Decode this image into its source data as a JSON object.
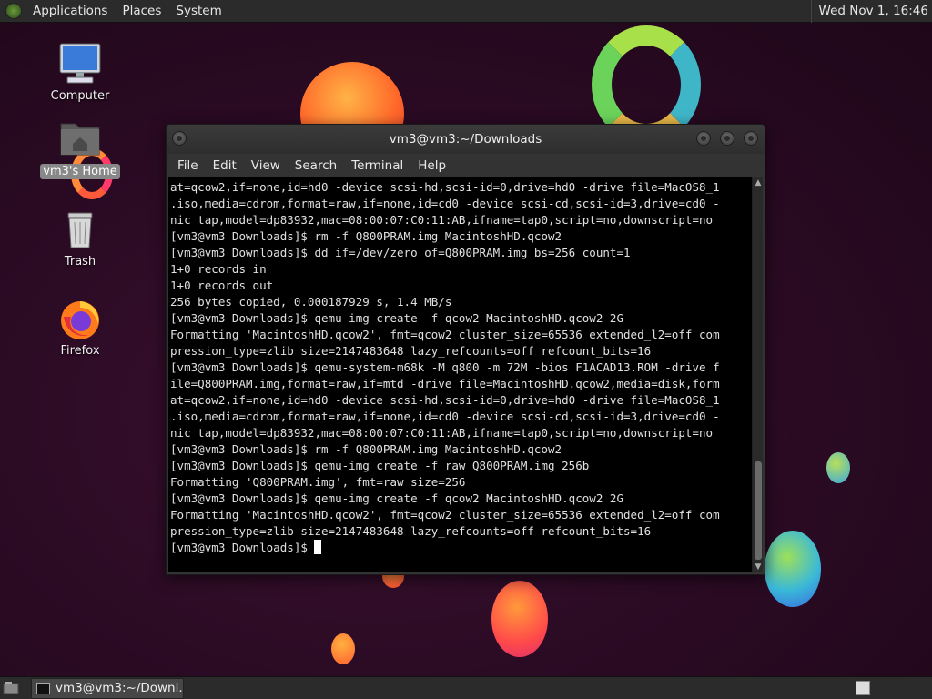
{
  "top_panel": {
    "menus": [
      "Applications",
      "Places",
      "System"
    ],
    "clock": "Wed Nov 1, 16:46"
  },
  "desktop": {
    "icons": [
      {
        "label": "Computer",
        "icon": "computer-icon"
      },
      {
        "label": "vm3's Home",
        "icon": "home-folder-icon"
      },
      {
        "label": "Trash",
        "icon": "trash-icon"
      },
      {
        "label": "Firefox",
        "icon": "firefox-icon"
      }
    ]
  },
  "terminal": {
    "title": "vm3@vm3:~/Downloads",
    "menu": [
      "File",
      "Edit",
      "View",
      "Search",
      "Terminal",
      "Help"
    ],
    "lines": [
      "at=qcow2,if=none,id=hd0 -device scsi-hd,scsi-id=0,drive=hd0 -drive file=MacOS8_1",
      ".iso,media=cdrom,format=raw,if=none,id=cd0 -device scsi-cd,scsi-id=3,drive=cd0 -",
      "nic tap,model=dp83932,mac=08:00:07:C0:11:AB,ifname=tap0,script=no,downscript=no",
      "[vm3@vm3 Downloads]$ rm -f Q800PRAM.img MacintoshHD.qcow2",
      "[vm3@vm3 Downloads]$ dd if=/dev/zero of=Q800PRAM.img bs=256 count=1",
      "1+0 records in",
      "1+0 records out",
      "256 bytes copied, 0.000187929 s, 1.4 MB/s",
      "[vm3@vm3 Downloads]$ qemu-img create -f qcow2 MacintoshHD.qcow2 2G",
      "Formatting 'MacintoshHD.qcow2', fmt=qcow2 cluster_size=65536 extended_l2=off com",
      "pression_type=zlib size=2147483648 lazy_refcounts=off refcount_bits=16",
      "[vm3@vm3 Downloads]$ qemu-system-m68k -M q800 -m 72M -bios F1ACAD13.ROM -drive f",
      "ile=Q800PRAM.img,format=raw,if=mtd -drive file=MacintoshHD.qcow2,media=disk,form",
      "at=qcow2,if=none,id=hd0 -device scsi-hd,scsi-id=0,drive=hd0 -drive file=MacOS8_1",
      ".iso,media=cdrom,format=raw,if=none,id=cd0 -device scsi-cd,scsi-id=3,drive=cd0 -",
      "nic tap,model=dp83932,mac=08:00:07:C0:11:AB,ifname=tap0,script=no,downscript=no",
      "[vm3@vm3 Downloads]$ rm -f Q800PRAM.img MacintoshHD.qcow2",
      "[vm3@vm3 Downloads]$ qemu-img create -f raw Q800PRAM.img 256b",
      "Formatting 'Q800PRAM.img', fmt=raw size=256",
      "[vm3@vm3 Downloads]$ qemu-img create -f qcow2 MacintoshHD.qcow2 2G",
      "Formatting 'MacintoshHD.qcow2', fmt=qcow2 cluster_size=65536 extended_l2=off com",
      "pression_type=zlib size=2147483648 lazy_refcounts=off refcount_bits=16"
    ],
    "prompt": "[vm3@vm3 Downloads]$ "
  },
  "bottom_panel": {
    "task_label": "vm3@vm3:~/Downl..."
  },
  "colors": {
    "panel": "#2b2b2b",
    "terminal_bg": "#000000",
    "terminal_fg": "#e0e0e0",
    "desktop_bg": "#2c0b25"
  }
}
